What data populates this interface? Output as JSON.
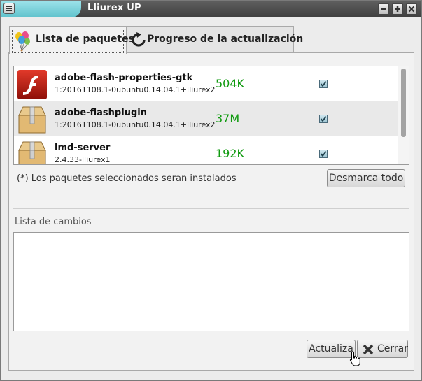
{
  "window": {
    "title": "Lliurex UP"
  },
  "tabs": [
    {
      "label": "Lista de paquetes",
      "active": true
    },
    {
      "label": "Progreso de la actualización",
      "active": false
    }
  ],
  "packages": [
    {
      "name": "adobe-flash-properties-gtk",
      "version": "1:20161108.1-0ubuntu0.14.04.1+lliurex2",
      "size": "504K",
      "checked": true,
      "icon": "flash-icon"
    },
    {
      "name": "adobe-flashplugin",
      "version": "1:20161108.1-0ubuntu0.14.04.1+lliurex2",
      "size": "37M",
      "checked": true,
      "icon": "package-box-icon"
    },
    {
      "name": "lmd-server",
      "version": "2.4.33-lliurex1",
      "size": "192K",
      "checked": true,
      "icon": "package-box-icon"
    }
  ],
  "selection_note": "(*) Los paquetes seleccionados seran instalados",
  "buttons": {
    "unselect_all": "Desmarca todo",
    "update": "Actualiza",
    "close": "Cerrar"
  },
  "changes": {
    "label": "Lista de cambios",
    "content": ""
  },
  "colors": {
    "size_text": "#0f9a0f",
    "titlebar_accent": "#6ccbd4"
  }
}
